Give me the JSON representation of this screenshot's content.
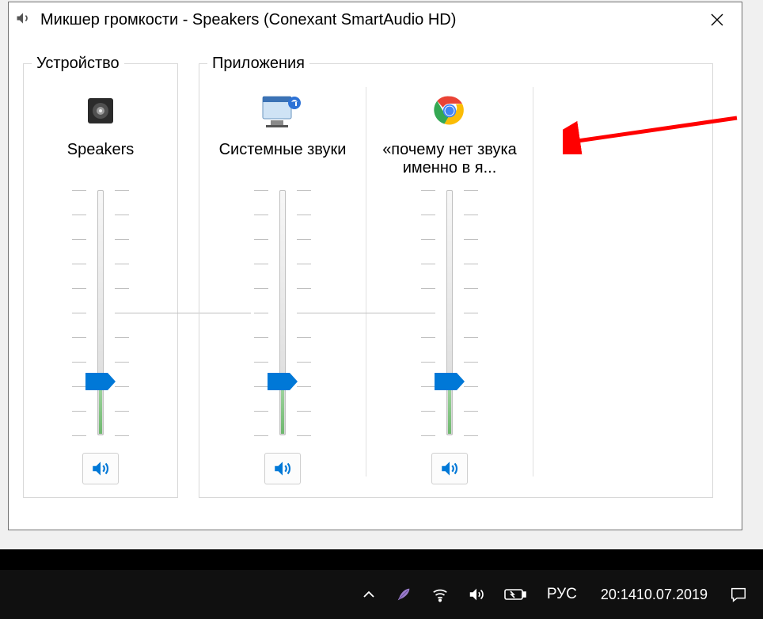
{
  "window": {
    "title": "Микшер громкости - Speakers (Conexant SmartAudio HD)"
  },
  "sections": {
    "device_legend": "Устройство",
    "apps_legend": "Приложения"
  },
  "channels": [
    {
      "label": "Speakers",
      "pos": 22,
      "icon": "speaker-device"
    },
    {
      "label": "Системные звуки",
      "pos": 22,
      "icon": "system-sounds"
    },
    {
      "label": "«почему нет звука именно в я...",
      "pos": 22,
      "icon": "chrome"
    }
  ],
  "tray": {
    "lang": "РУС",
    "time": "20:14",
    "date": "10.07.2019"
  },
  "colors": {
    "accent": "#0078d7",
    "arrow": "#ff0000"
  }
}
